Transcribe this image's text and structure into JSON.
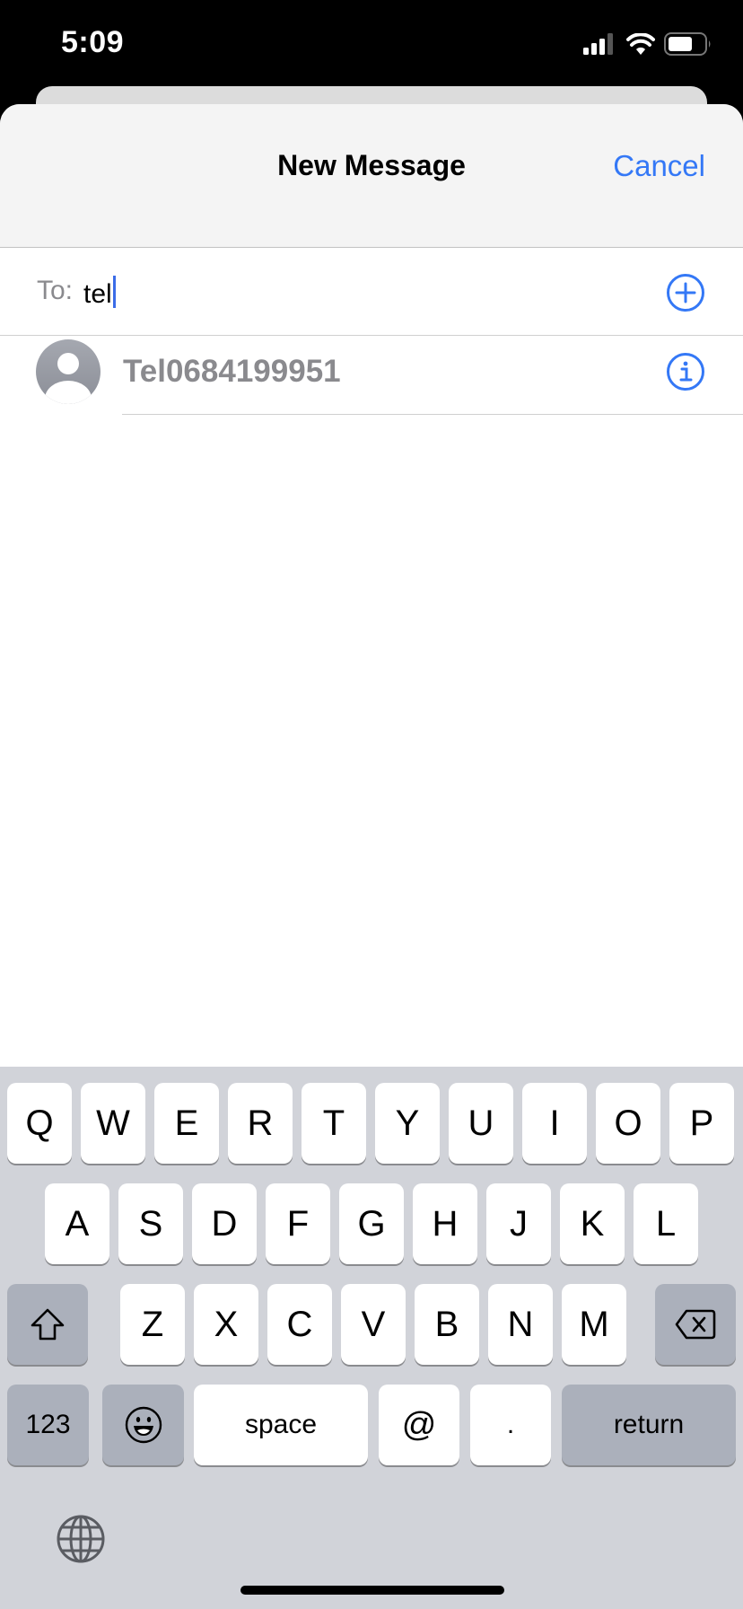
{
  "status_bar": {
    "time": "5:09",
    "icons": [
      "cellular-signal-icon",
      "wifi-icon",
      "battery-icon"
    ]
  },
  "nav": {
    "title": "New Message",
    "cancel_label": "Cancel"
  },
  "recipient": {
    "label": "To:",
    "value": "tel",
    "add_icon": "plus-circle-icon"
  },
  "suggestions": [
    {
      "name": "Tel0684199951",
      "avatar_icon": "person-icon",
      "action_icon": "info-icon"
    }
  ],
  "keyboard": {
    "row1": [
      "Q",
      "W",
      "E",
      "R",
      "T",
      "Y",
      "U",
      "I",
      "O",
      "P"
    ],
    "row2": [
      "A",
      "S",
      "D",
      "F",
      "G",
      "H",
      "J",
      "K",
      "L"
    ],
    "row3": [
      "Z",
      "X",
      "C",
      "V",
      "B",
      "N",
      "M"
    ],
    "shift_icon": "shift-icon",
    "delete_icon": "delete-icon",
    "numbers_label": "123",
    "emoji_icon": "emoji-icon",
    "space_label": "space",
    "at_label": "@",
    "period_label": ".",
    "return_label": "return",
    "globe_icon": "globe-icon"
  },
  "colors": {
    "accent": "#3478f6",
    "caret": "#3b6ce8",
    "secondary_text": "#8a8a8e",
    "keyboard_bg": "#d1d3d9",
    "function_key": "#abb0bb"
  }
}
